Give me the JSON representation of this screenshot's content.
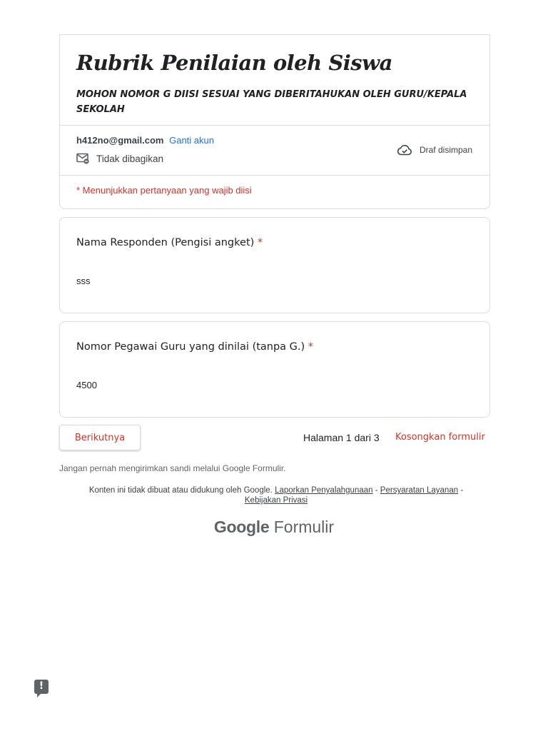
{
  "header": {
    "title": "Rubrik Penilaian oleh Siswa",
    "description": "MOHON NOMOR G DIISI SESUAI YANG DIBERITAHUKAN OLEH GURU/KEPALA SEKOLAH",
    "account_email": "h412no@gmail.com",
    "switch_account": "Ganti akun",
    "share_status": "Tidak dibagikan",
    "draft_status": "Draf disimpan",
    "required_note": "* Menunjukkan pertanyaan yang wajib diisi"
  },
  "questions": [
    {
      "label": "Nama Responden (Pengisi angket)",
      "required_mark": "*",
      "answer": "sss"
    },
    {
      "label": "Nomor Pegawai Guru yang dinilai (tanpa G.)",
      "required_mark": "*",
      "answer": "4500"
    }
  ],
  "navigation": {
    "next_label": "Berikutnya",
    "page_indicator": "Halaman 1 dari 3",
    "clear_label": "Kosongkan formulir"
  },
  "footer": {
    "never_submit": "Jangan pernah mengirimkan sandi melalui Google Formulir.",
    "disclaimer_text": "Konten ini tidak dibuat atau didukung oleh Google.",
    "link_report": "Laporkan Penyalahgunaan",
    "separator": "-",
    "link_terms": "Persyaratan Layanan",
    "link_privacy": "Kebijakan Privasi",
    "brand_google": "Google",
    "brand_forms": "Formulir"
  },
  "report_button": {
    "glyph": "!"
  },
  "colors": {
    "required": "#d93025",
    "link": "#1a73e8",
    "text": "#202124",
    "border": "#dadce0"
  },
  "icons": [
    "mail-icon",
    "cloud-check-icon",
    "report-icon"
  ]
}
